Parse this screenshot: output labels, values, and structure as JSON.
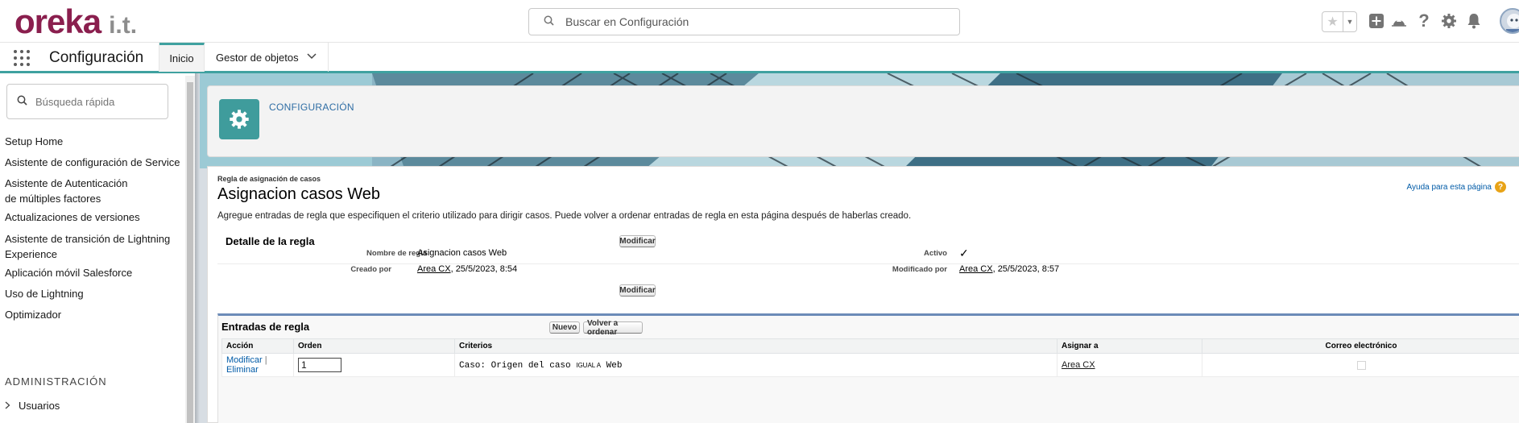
{
  "header": {
    "logo_main": "oreka",
    "logo_suffix": "i.t.",
    "search_placeholder": "Buscar en Configuración",
    "icons": [
      "star-icon",
      "add-icon",
      "trailhead-icon",
      "help-icon",
      "gear-icon",
      "bell-icon",
      "avatar"
    ]
  },
  "nav": {
    "app_name": "Configuración",
    "tabs": [
      {
        "label": "Inicio",
        "active": true
      },
      {
        "label": "Gestor de objetos",
        "has_dropdown": true
      }
    ]
  },
  "sidebar": {
    "search_placeholder": "Búsqueda rápida",
    "items": [
      {
        "label": "Setup Home"
      },
      {
        "label": "Asistente de configuración de Service"
      },
      {
        "label": "Asistente de Autenticación de múltiples factores"
      },
      {
        "label": "Actualizaciones de versiones"
      },
      {
        "label": "Asistente de transición de Lightning Experience"
      },
      {
        "label": "Aplicación móvil Salesforce"
      },
      {
        "label": "Uso de Lightning"
      },
      {
        "label": "Optimizador"
      }
    ],
    "section_heading": "ADMINISTRACIÓN",
    "section_items": [
      {
        "label": "Usuarios"
      }
    ]
  },
  "setup_header": {
    "title": "CONFIGURACIÓN"
  },
  "rule": {
    "breadcrumb": "Regla de asignación de casos",
    "title": "Asignacion casos Web",
    "help_link": "Ayuda para esta página",
    "description": "Agregue entradas de regla que especifiquen el criterio utilizado para dirigir casos. Puede volver a ordenar entradas de regla en esta página después de haberlas creado.",
    "detail": {
      "heading": "Detalle de la regla",
      "edit_button": "Modificar",
      "name_label": "Nombre de regla",
      "name_value": "Asignacion casos Web",
      "active_label": "Activo",
      "active_value": "✓",
      "created_label": "Creado por",
      "created_user": "Area CX",
      "created_date": ", 25/5/2023, 8:54",
      "modified_label": "Modificado por",
      "modified_user": "Area CX",
      "modified_date": ", 25/5/2023, 8:57"
    },
    "entries": {
      "heading": "Entradas de regla",
      "new_button": "Nuevo",
      "reorder_button": "Volver a ordenar",
      "columns": [
        "Acción",
        "Orden",
        "Criterios",
        "Asignar a",
        "Correo electrónico"
      ],
      "rows": [
        {
          "edit_link": "Modificar",
          "separator": "|",
          "delete_link": "Eliminar",
          "order": "1",
          "criteria_prefix": "Caso: Origen del caso ",
          "criteria_operator": "IGUAL A",
          "criteria_value": " Web",
          "assign_to": "Area CX",
          "email": false
        }
      ]
    }
  }
}
